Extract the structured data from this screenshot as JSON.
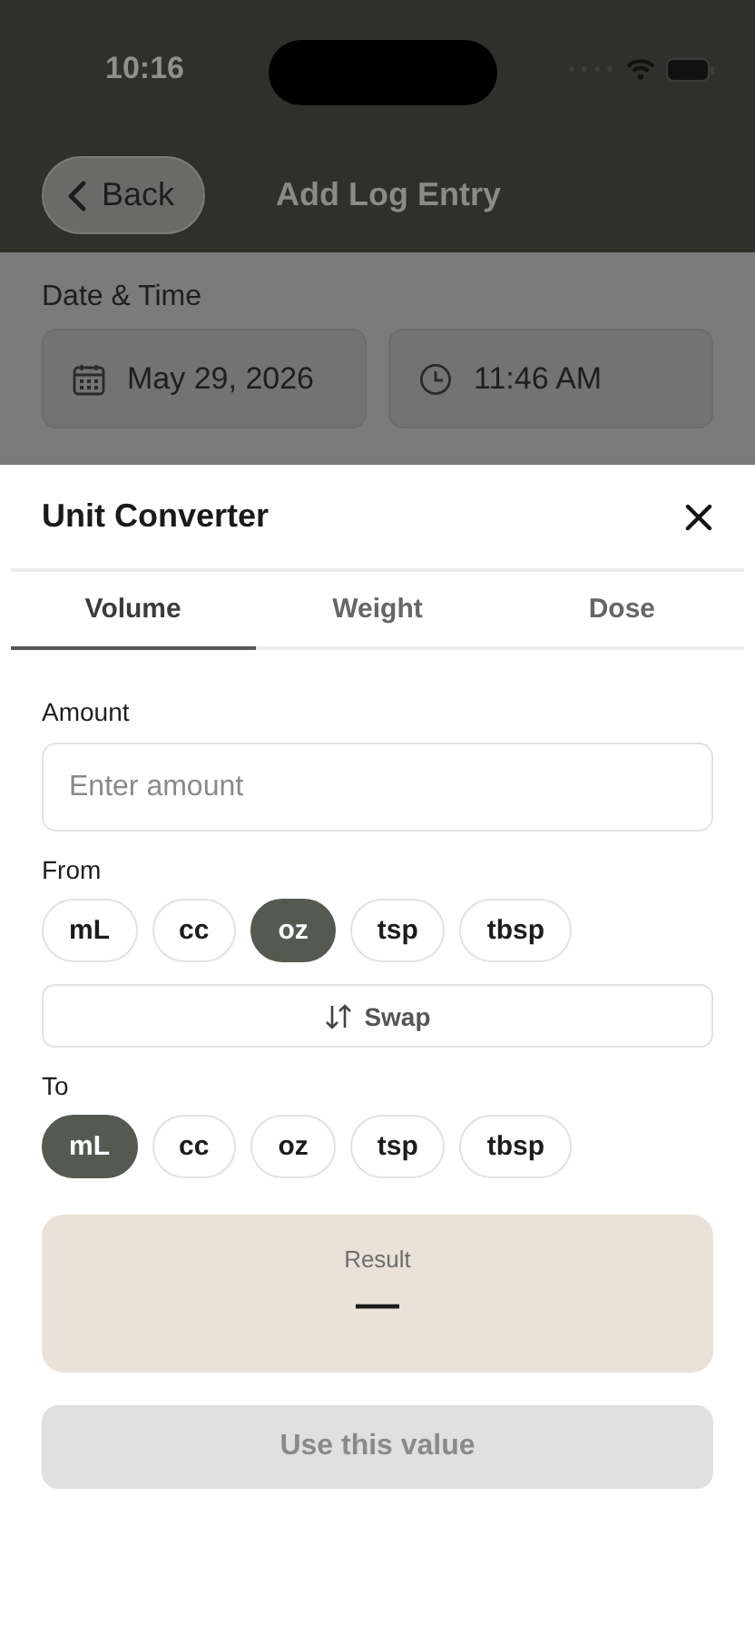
{
  "status_bar": {
    "time": "10:16"
  },
  "nav_bar": {
    "back_label": "Back",
    "title": "Add Log Entry"
  },
  "date_time": {
    "label": "Date & Time",
    "date": "May 29, 2026",
    "time": "11:46 AM"
  },
  "sheet": {
    "title": "Unit Converter",
    "tabs": [
      {
        "label": "Volume",
        "selected": true
      },
      {
        "label": "Weight",
        "selected": false
      },
      {
        "label": "Dose",
        "selected": false
      }
    ],
    "amount": {
      "label": "Amount",
      "placeholder": "Enter amount"
    },
    "from": {
      "label": "From",
      "units": [
        {
          "label": "mL",
          "selected": false
        },
        {
          "label": "cc",
          "selected": false
        },
        {
          "label": "oz",
          "selected": true
        },
        {
          "label": "tsp",
          "selected": false
        },
        {
          "label": "tbsp",
          "selected": false
        }
      ]
    },
    "swap_label": "Swap",
    "to": {
      "label": "To",
      "units": [
        {
          "label": "mL",
          "selected": true
        },
        {
          "label": "cc",
          "selected": false
        },
        {
          "label": "oz",
          "selected": false
        },
        {
          "label": "tsp",
          "selected": false
        },
        {
          "label": "tbsp",
          "selected": false
        }
      ]
    },
    "result": {
      "label": "Result",
      "value": "—"
    },
    "use_button": {
      "label": "Use this value",
      "disabled": true
    }
  }
}
